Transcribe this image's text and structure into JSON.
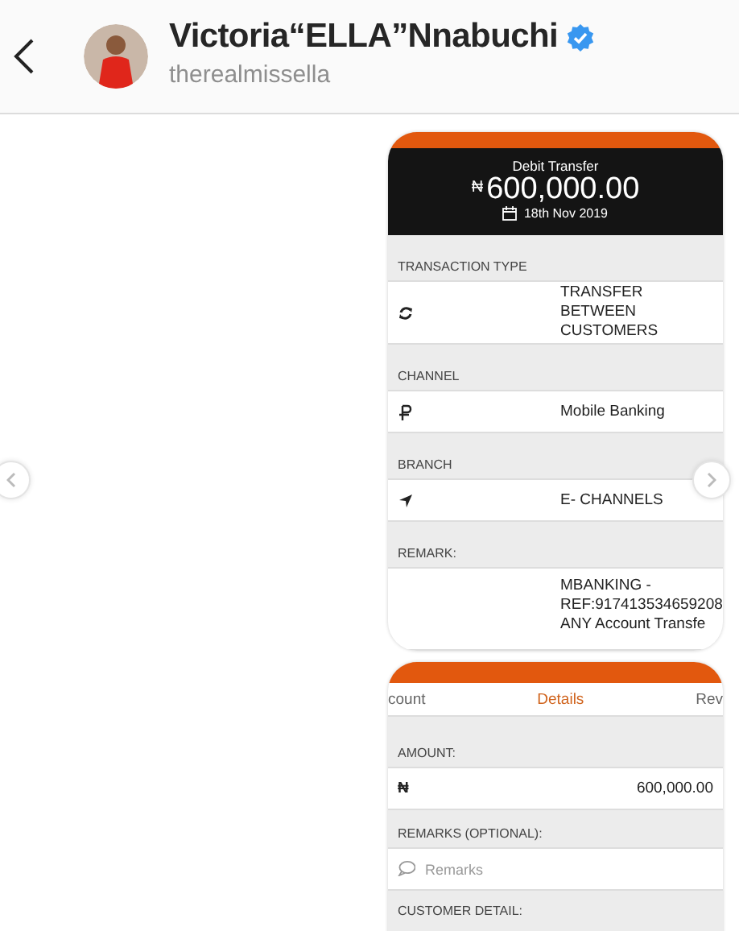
{
  "header": {
    "name": "Victoria“ELLA”Nnabuchi",
    "verified": true,
    "handle": "therealmissella"
  },
  "receipt": {
    "title": "Debit Transfer",
    "currency": "₦",
    "amount": "600,000.00",
    "date": "18th Nov 2019",
    "fields": [
      {
        "label": "TRANSACTION TYPE",
        "kind": "refresh",
        "value": "TRANSFER\nBETWEEN\nCUSTOMERS"
      },
      {
        "label": "CHANNEL",
        "kind": "currency",
        "value": "Mobile Banking"
      },
      {
        "label": "BRANCH",
        "kind": "location",
        "value": "E- CHANNELS"
      },
      {
        "label": "REMARK:",
        "value": "MBANKING -\nREF:917413534659208\nANY Account Transfe"
      }
    ]
  },
  "transfer": {
    "tabs": [
      {
        "label": "count",
        "selected": false
      },
      {
        "label": "Details",
        "selected": true
      },
      {
        "label": "Rev",
        "selected": false
      }
    ],
    "amount_label": "AMOUNT:",
    "currency": "₦",
    "amount": "600,000.00",
    "remarks_label": "REMARKS (OPTIONAL):",
    "remarks_placeholder": "Remarks",
    "customer_label": "CUSTOMER DETAIL:"
  }
}
